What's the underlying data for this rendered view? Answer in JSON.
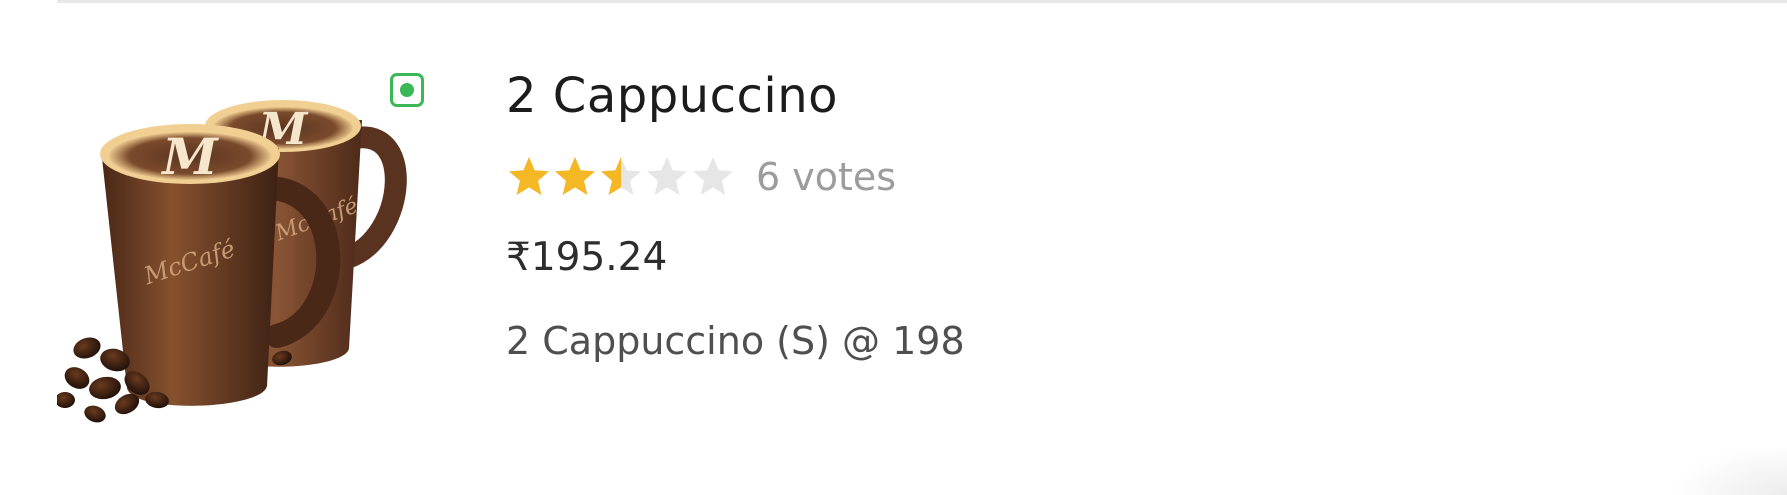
{
  "item": {
    "name": "2 Cappuccino",
    "rating": {
      "value": 2.5,
      "max": 5,
      "filled_color": "#f3b823",
      "empty_color": "#e6e6e6",
      "votes_text": "6 votes"
    },
    "price": "₹195.24",
    "description": "2 Cappuccino (S) @ 198",
    "veg_indicator_color": "#3ab757",
    "image": {
      "icon": "coffee-mugs-image",
      "logo_text": "McCafé",
      "latte_art_letter": "M"
    }
  }
}
